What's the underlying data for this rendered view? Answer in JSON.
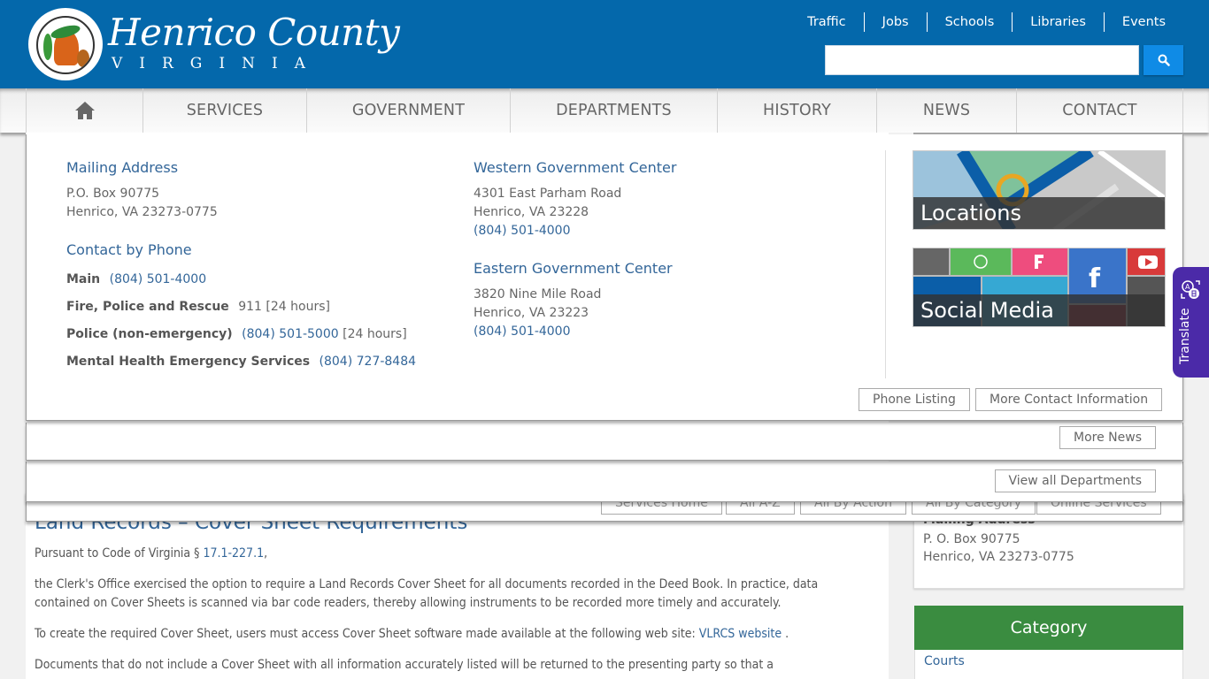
{
  "header": {
    "brand_title": "Henrico County",
    "brand_subtitle": "VIRGINIA",
    "top_links": [
      "Traffic",
      "Jobs",
      "Schools",
      "Libraries",
      "Events"
    ],
    "search": {
      "value": "",
      "placeholder": "",
      "icon": "search-icon"
    }
  },
  "nav": {
    "home_icon": "home-icon",
    "items": [
      "SERVICES",
      "GOVERNMENT",
      "DEPARTMENTS",
      "HISTORY",
      "NEWS",
      "CONTACT"
    ]
  },
  "contact_panel": {
    "mailing": {
      "heading": "Mailing Address",
      "lines": [
        "P.O. Box 90775",
        "Henrico, VA 23273-0775"
      ]
    },
    "phone": {
      "heading": "Contact by Phone",
      "rows": [
        {
          "label": "Main",
          "phone": "(804) 501-4000",
          "note": ""
        },
        {
          "label": "Fire, Police and Rescue",
          "phone": "",
          "note": "911 [24 hours]"
        },
        {
          "label": "Police (non-emergency)",
          "phone": "(804) 501-5000",
          "note": "[24 hours]"
        },
        {
          "label": "Mental Health Emergency Services",
          "phone": "(804) 727-8484",
          "note": ""
        }
      ]
    },
    "western": {
      "heading": "Western Government Center",
      "lines": [
        "4301 East Parham Road",
        "Henrico, VA 23228"
      ],
      "phone": "(804) 501-4000"
    },
    "eastern": {
      "heading": "Eastern Government Center",
      "lines": [
        "3820 Nine Mile Road",
        "Henrico, VA 23223"
      ],
      "phone": "(804) 501-4000"
    },
    "tiles": [
      {
        "label": "Locations"
      },
      {
        "label": "Social Media"
      }
    ],
    "buttons": [
      "Phone Listing",
      "More Contact Information"
    ]
  },
  "news_panel": {
    "button": "More News"
  },
  "departments_panel": {
    "button": "View all Departments"
  },
  "services_buttons": [
    "Services Home",
    "All A-Z",
    "All By Action",
    "All By Category",
    "Online Services"
  ],
  "content": {
    "title": "Land Records – Cover Sheet Requirements",
    "p1_prefix": "Pursuant to Code of Virginia § ",
    "p1_link": "17.1-227.1",
    "p1_suffix": ",",
    "p2": "the Clerk's Office exercised the option to require a Land Records Cover Sheet for all documents recorded in the Deed Book. In practice, data contained on Cover Sheets is scanned via bar code readers, thereby allowing instruments to be recorded more timely and accurately.",
    "p3_prefix": "To create the required Cover Sheet, users must access Cover Sheet software made available at the following web site: ",
    "p3_link": "VLRCS website",
    "p3_suffix": " .",
    "p4": "Documents that do not include a Cover Sheet with all information accurately listed will be returned to the presenting party so that a"
  },
  "sidebar": {
    "mailing_heading": "Mailing Address",
    "mailing_lines": [
      "P. O. Box 90775",
      "Henrico, VA 23273-0775"
    ],
    "category_heading": "Category",
    "category_items": [
      "Courts"
    ]
  },
  "translate": {
    "label": "Translate",
    "icon": "translate-icon"
  },
  "colors": {
    "header_blue": "#0468ab",
    "link_blue": "#336699",
    "search_button": "#0f8be6",
    "category_green": "#3a8c40",
    "translate_purple": "#4b2aa8"
  }
}
